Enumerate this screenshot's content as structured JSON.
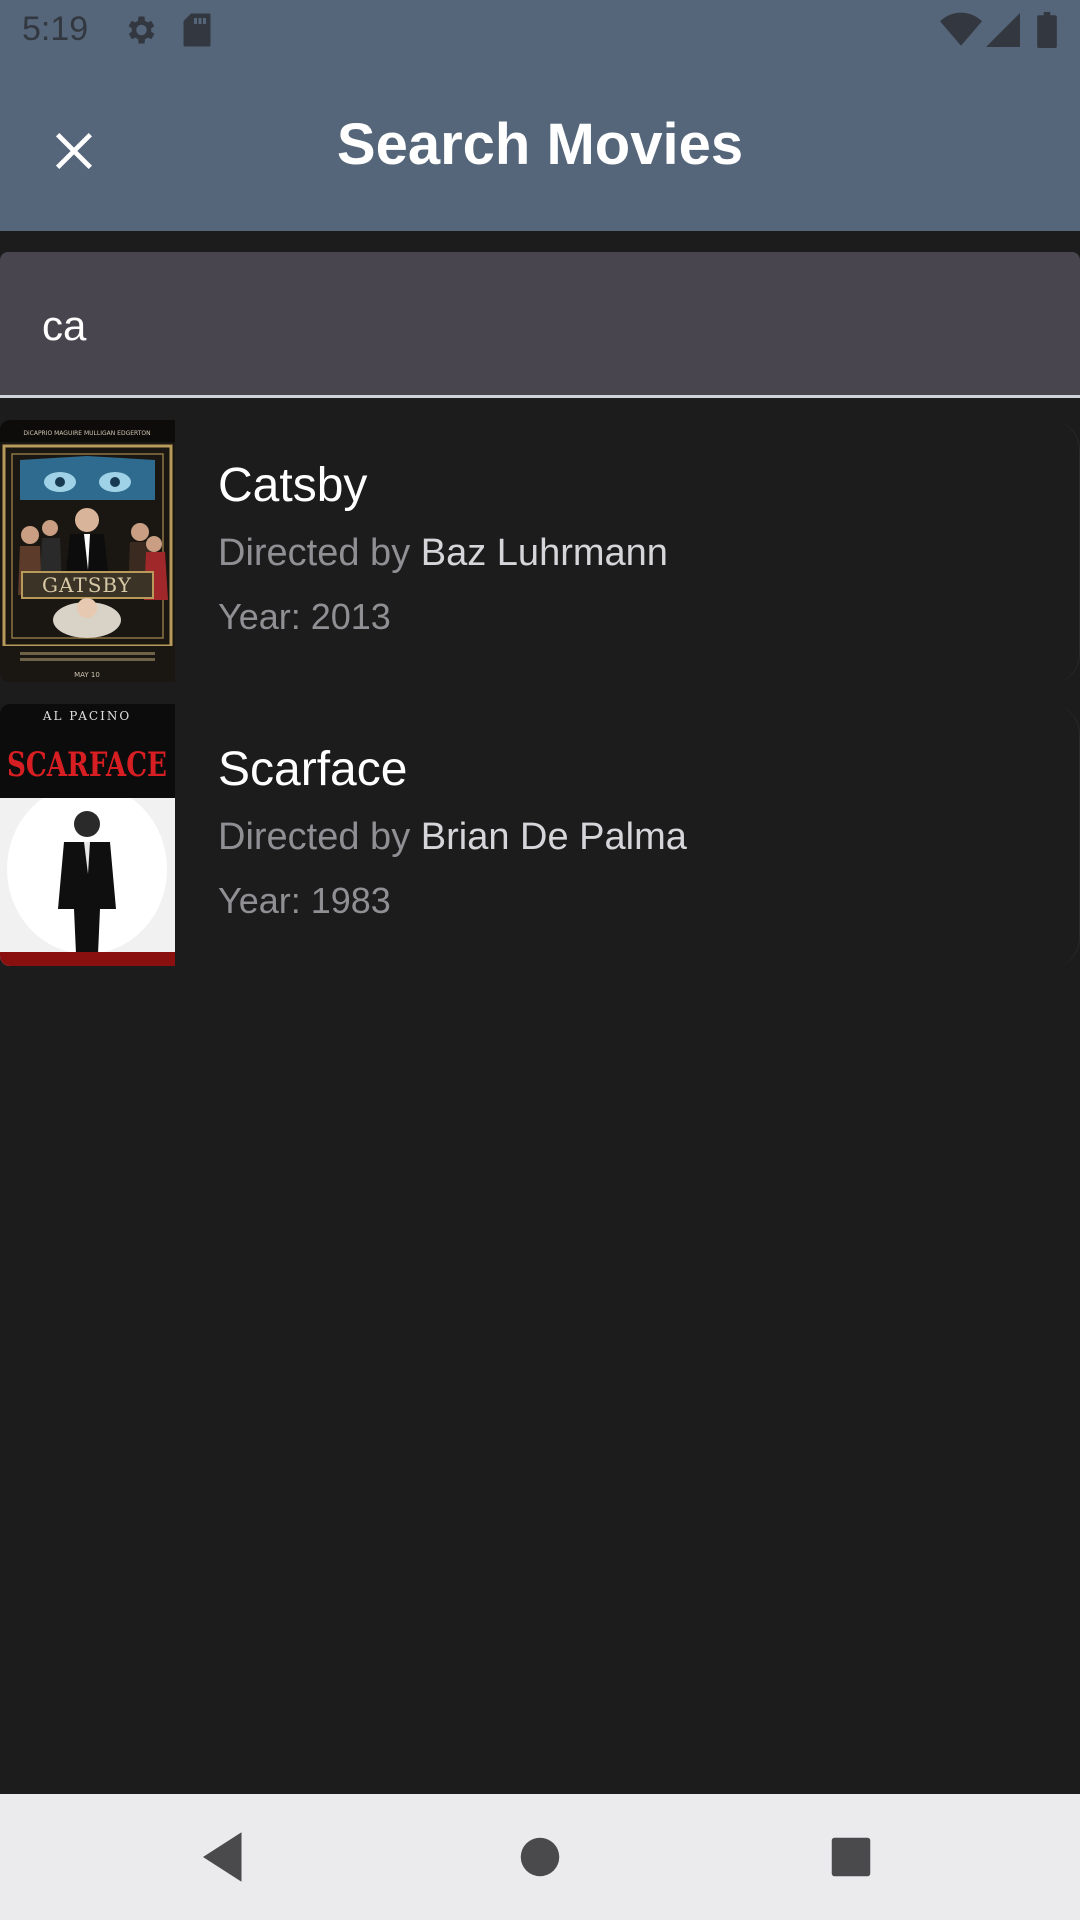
{
  "status_bar": {
    "time": "5:19",
    "icons_left": [
      "gear-icon",
      "sd-card-icon"
    ],
    "icons_right": [
      "wifi-icon",
      "signal-icon",
      "battery-icon"
    ]
  },
  "app_bar": {
    "title": "Search Movies",
    "close_icon": "close-icon"
  },
  "search": {
    "value": "ca"
  },
  "results": [
    {
      "title": "Catsby",
      "directed_by_label": "Directed by",
      "director": "Baz Luhrmann",
      "year_text": "Year: 2013",
      "poster": {
        "top_text": "DiCAPRIO MAGUIRE MULLIGAN EDGERTON",
        "title_text": "GATSBY",
        "bottom_text": "MAY 10"
      }
    },
    {
      "title": "Scarface",
      "directed_by_label": "Directed by",
      "director": "Brian De Palma",
      "year_text": "Year: 1983",
      "poster": {
        "top_text": "AL PACINO",
        "title_text": "SCARFACE"
      }
    }
  ],
  "nav_bar": {
    "icons": [
      "back-icon",
      "home-icon",
      "recents-icon"
    ]
  },
  "colors": {
    "app_bar": "#55667a",
    "background": "#1c1c1d",
    "search_field": "#49454f",
    "nav_bar": "#ebebee"
  }
}
